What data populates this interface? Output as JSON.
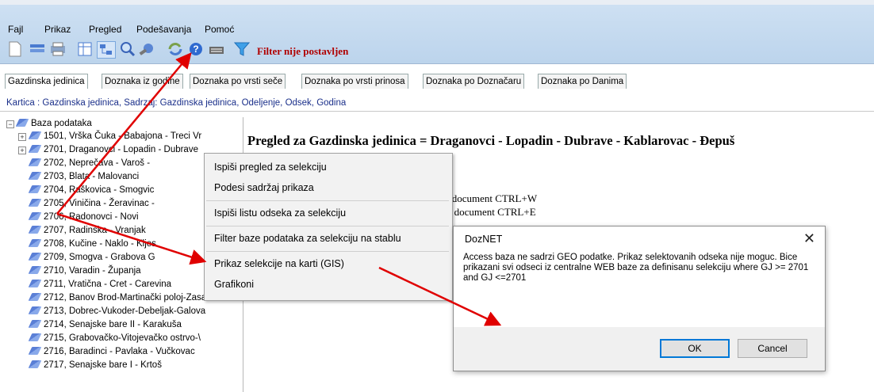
{
  "menu": [
    "Fajl",
    "Prikaz",
    "Pregled",
    "Podešavanja",
    "Pomoć"
  ],
  "toolbar": {
    "icons": [
      "new-doc-icon",
      "list-icon",
      "print-icon",
      "table-icon",
      "tree-icon",
      "search-icon",
      "tools-icon",
      "refresh-icon",
      "help-icon",
      "keyboard-icon",
      "filter-icon"
    ],
    "filter_status": "Filter nije postavljen"
  },
  "tabs": [
    "Gazdinska jedinica",
    "Doznaka iz godine",
    "Doznaka po vrsti seče",
    "Doznaka po vrsti prinosa",
    "Doznaka po Doznačaru",
    "Doznaka po Danima"
  ],
  "kartica": "Kartica :  Gazdinska jedinica, Sadrzaj: Gazdinska jedinica, Odeljenje, Odsek, Godina",
  "tree": {
    "root": "Baza podataka",
    "items": [
      "1501, Vrška Čuka - Babajona - Treci Vr",
      "2701, Draganovci - Lopadin - Dubrave",
      "2702, Neprečava - Varoš -",
      "2703, Blata - Malovanci",
      "2704, Raškovica - Smogvic",
      "2705, Viničina - Žeravinac -",
      "2706, Radonovci - Novi",
      "2707, Radinska - Vranjak",
      "2708, Kučine - Naklo - Kljes",
      "2709, Smogva - Grabova G",
      "2710, Varadin - Županja",
      "2711, Vratična - Cret - Carevina",
      "2712, Banov Brod-Martinački poloj-Zasa",
      "2713, Dobrec-Vukoder-Debeljak-Galova",
      "2714, Senajske bare II - Karakuša",
      "2715, Grabovačko-Vitojevačko ostrvo-\\",
      "2716, Baradinci - Pavlaka - Vučkovac",
      "2717, Senajske bare I - Krtoš"
    ]
  },
  "content": {
    "title": "Pregled za Gazdinska jedinica = Draganovci - Lopadin - Dubrave - Kablarovac - Đepuš",
    "lines": [
      "d document  CTRL+W",
      "el document  CTRL+E"
    ]
  },
  "context_menu": [
    "Ispiši pregled za selekciju",
    "Podesi sadržaj prikaza",
    "Ispiši listu odseka za selekciju",
    "Filter baze podataka za selekciju na stablu",
    "Prikaz selekcije na karti (GIS)",
    "Grafikoni"
  ],
  "dialog": {
    "title": "DozNET",
    "close": "✕",
    "message": "Access baza ne sadrzi GEO podatke. Prikaz selektovanih odseka nije moguc. Bice prikazani svi odseci iz centralne WEB baze za definisanu selekciju  where GJ >= 2701 and GJ <=2701",
    "ok": "OK",
    "cancel": "Cancel"
  },
  "colors": {
    "arrow": "#e00000",
    "filter_text": "#b00000",
    "kartica": "#1a2f8a"
  }
}
